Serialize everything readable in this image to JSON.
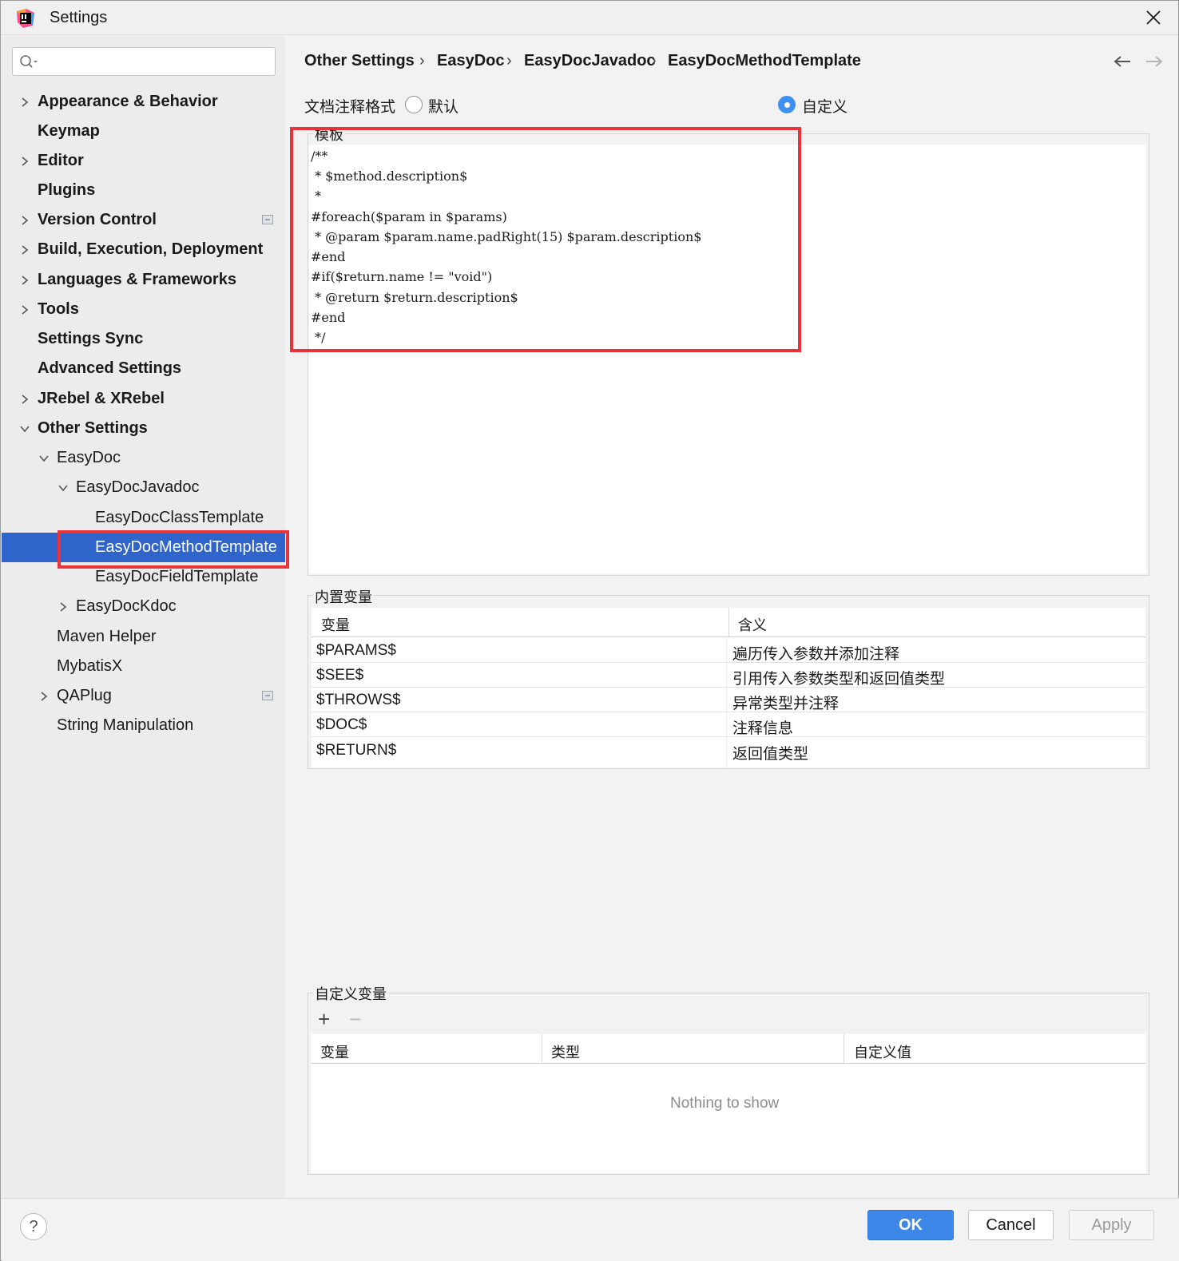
{
  "window": {
    "title": "Settings"
  },
  "search": {
    "placeholder": ""
  },
  "sidebar": {
    "items": [
      {
        "label": "Appearance & Behavior"
      },
      {
        "label": "Keymap"
      },
      {
        "label": "Editor"
      },
      {
        "label": "Plugins"
      },
      {
        "label": "Version Control"
      },
      {
        "label": "Build, Execution, Deployment"
      },
      {
        "label": "Languages & Frameworks"
      },
      {
        "label": "Tools"
      },
      {
        "label": "Settings Sync"
      },
      {
        "label": "Advanced Settings"
      },
      {
        "label": "JRebel & XRebel"
      },
      {
        "label": "Other Settings"
      },
      {
        "label": "EasyDoc"
      },
      {
        "label": "EasyDocJavadoc"
      },
      {
        "label": "EasyDocClassTemplate"
      },
      {
        "label": "EasyDocMethodTemplate"
      },
      {
        "label": "EasyDocFieldTemplate"
      },
      {
        "label": "EasyDocKdoc"
      },
      {
        "label": "Maven Helper"
      },
      {
        "label": "MybatisX"
      },
      {
        "label": "QAPlug"
      },
      {
        "label": "String Manipulation"
      }
    ]
  },
  "breadcrumb": [
    "Other Settings",
    "EasyDoc",
    "EasyDocJavadoc",
    "EasyDocMethodTemplate"
  ],
  "breadcrumb_sep": "›",
  "format": {
    "label": "文档注释格式",
    "option_default": "默认",
    "option_custom": "自定义",
    "selected": "自定义"
  },
  "template": {
    "legend": "模板",
    "lines": [
      "/**",
      " * $method.description$",
      " *",
      "#foreach($param in $params)",
      " * @param $param.name.padRight(15) $param.description$",
      "#end",
      "#if($return.name != \"void\")",
      " * @return $return.description$",
      "#end",
      " */"
    ]
  },
  "builtin": {
    "legend": "内置变量",
    "headers": [
      "变量",
      "含义"
    ],
    "rows": [
      [
        "$PARAMS$",
        "遍历传入参数并添加注释"
      ],
      [
        "$SEE$",
        "引用传入参数类型和返回值类型"
      ],
      [
        "$THROWS$",
        "异常类型并注释"
      ],
      [
        "$DOC$",
        "注释信息"
      ],
      [
        "$RETURN$",
        "返回值类型"
      ]
    ]
  },
  "custom": {
    "legend": "自定义变量",
    "add_label": "+",
    "remove_label": "−",
    "headers": [
      "变量",
      "类型",
      "自定义值"
    ],
    "empty_text": "Nothing to show"
  },
  "footer": {
    "help_label": "?",
    "ok_label": "OK",
    "cancel_label": "Cancel",
    "apply_label": "Apply"
  },
  "colors": {
    "selection": "#2f65ca",
    "highlight_box": "#e8333a",
    "primary_button": "#3d87e8",
    "radio_checked": "#3d8ff2"
  }
}
